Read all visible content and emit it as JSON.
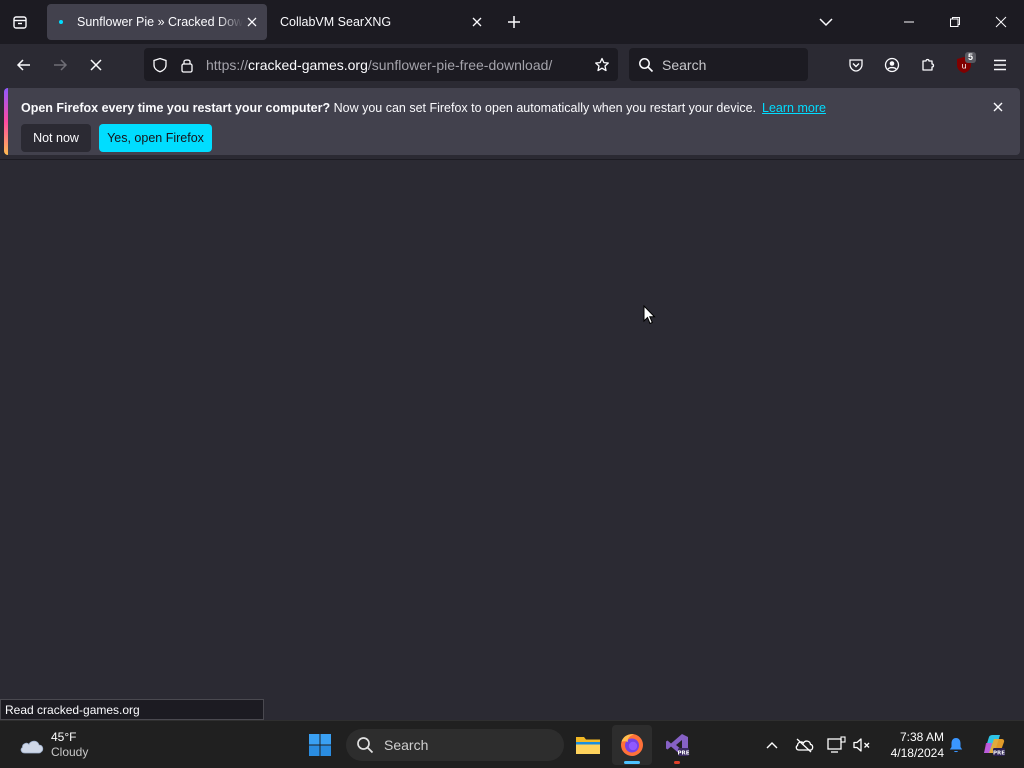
{
  "browser": {
    "tabs": [
      {
        "title": "Sunflower Pie » Cracked Downloads",
        "active": true
      },
      {
        "title": "CollabVM SearXNG",
        "active": false
      }
    ],
    "url": {
      "scheme": "https://",
      "host": "cracked-games.org",
      "path": "/sunflower-pie-free-download/"
    },
    "search_placeholder": "Search",
    "extension_badge": "5",
    "status_text": "Read cracked-games.org"
  },
  "notification": {
    "bold": "Open Firefox every time you restart your computer?",
    "text": " Now you can set Firefox to open automatically when you restart your device.",
    "link": "Learn more",
    "secondary_button": "Not now",
    "primary_button": "Yes, open Firefox"
  },
  "taskbar": {
    "weather": {
      "temp": "45°F",
      "condition": "Cloudy"
    },
    "search_placeholder": "Search",
    "clock": {
      "time": "7:38 AM",
      "date": "4/18/2024"
    }
  },
  "colors": {
    "accent": "#00ddff",
    "tab_bg": "#1c1b22",
    "page_bg": "#2b2a33"
  }
}
